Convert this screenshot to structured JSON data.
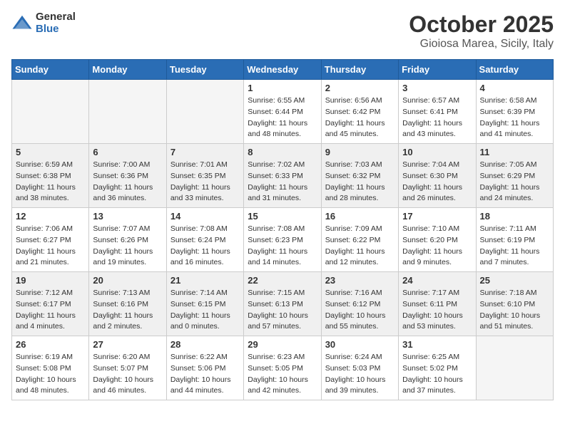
{
  "logo": {
    "general": "General",
    "blue": "Blue"
  },
  "title": "October 2025",
  "location": "Gioiosa Marea, Sicily, Italy",
  "days_of_week": [
    "Sunday",
    "Monday",
    "Tuesday",
    "Wednesday",
    "Thursday",
    "Friday",
    "Saturday"
  ],
  "weeks": [
    [
      {
        "day": "",
        "info": ""
      },
      {
        "day": "",
        "info": ""
      },
      {
        "day": "",
        "info": ""
      },
      {
        "day": "1",
        "info": "Sunrise: 6:55 AM\nSunset: 6:44 PM\nDaylight: 11 hours\nand 48 minutes."
      },
      {
        "day": "2",
        "info": "Sunrise: 6:56 AM\nSunset: 6:42 PM\nDaylight: 11 hours\nand 45 minutes."
      },
      {
        "day": "3",
        "info": "Sunrise: 6:57 AM\nSunset: 6:41 PM\nDaylight: 11 hours\nand 43 minutes."
      },
      {
        "day": "4",
        "info": "Sunrise: 6:58 AM\nSunset: 6:39 PM\nDaylight: 11 hours\nand 41 minutes."
      }
    ],
    [
      {
        "day": "5",
        "info": "Sunrise: 6:59 AM\nSunset: 6:38 PM\nDaylight: 11 hours\nand 38 minutes."
      },
      {
        "day": "6",
        "info": "Sunrise: 7:00 AM\nSunset: 6:36 PM\nDaylight: 11 hours\nand 36 minutes."
      },
      {
        "day": "7",
        "info": "Sunrise: 7:01 AM\nSunset: 6:35 PM\nDaylight: 11 hours\nand 33 minutes."
      },
      {
        "day": "8",
        "info": "Sunrise: 7:02 AM\nSunset: 6:33 PM\nDaylight: 11 hours\nand 31 minutes."
      },
      {
        "day": "9",
        "info": "Sunrise: 7:03 AM\nSunset: 6:32 PM\nDaylight: 11 hours\nand 28 minutes."
      },
      {
        "day": "10",
        "info": "Sunrise: 7:04 AM\nSunset: 6:30 PM\nDaylight: 11 hours\nand 26 minutes."
      },
      {
        "day": "11",
        "info": "Sunrise: 7:05 AM\nSunset: 6:29 PM\nDaylight: 11 hours\nand 24 minutes."
      }
    ],
    [
      {
        "day": "12",
        "info": "Sunrise: 7:06 AM\nSunset: 6:27 PM\nDaylight: 11 hours\nand 21 minutes."
      },
      {
        "day": "13",
        "info": "Sunrise: 7:07 AM\nSunset: 6:26 PM\nDaylight: 11 hours\nand 19 minutes."
      },
      {
        "day": "14",
        "info": "Sunrise: 7:08 AM\nSunset: 6:24 PM\nDaylight: 11 hours\nand 16 minutes."
      },
      {
        "day": "15",
        "info": "Sunrise: 7:08 AM\nSunset: 6:23 PM\nDaylight: 11 hours\nand 14 minutes."
      },
      {
        "day": "16",
        "info": "Sunrise: 7:09 AM\nSunset: 6:22 PM\nDaylight: 11 hours\nand 12 minutes."
      },
      {
        "day": "17",
        "info": "Sunrise: 7:10 AM\nSunset: 6:20 PM\nDaylight: 11 hours\nand 9 minutes."
      },
      {
        "day": "18",
        "info": "Sunrise: 7:11 AM\nSunset: 6:19 PM\nDaylight: 11 hours\nand 7 minutes."
      }
    ],
    [
      {
        "day": "19",
        "info": "Sunrise: 7:12 AM\nSunset: 6:17 PM\nDaylight: 11 hours\nand 4 minutes."
      },
      {
        "day": "20",
        "info": "Sunrise: 7:13 AM\nSunset: 6:16 PM\nDaylight: 11 hours\nand 2 minutes."
      },
      {
        "day": "21",
        "info": "Sunrise: 7:14 AM\nSunset: 6:15 PM\nDaylight: 11 hours\nand 0 minutes."
      },
      {
        "day": "22",
        "info": "Sunrise: 7:15 AM\nSunset: 6:13 PM\nDaylight: 10 hours\nand 57 minutes."
      },
      {
        "day": "23",
        "info": "Sunrise: 7:16 AM\nSunset: 6:12 PM\nDaylight: 10 hours\nand 55 minutes."
      },
      {
        "day": "24",
        "info": "Sunrise: 7:17 AM\nSunset: 6:11 PM\nDaylight: 10 hours\nand 53 minutes."
      },
      {
        "day": "25",
        "info": "Sunrise: 7:18 AM\nSunset: 6:10 PM\nDaylight: 10 hours\nand 51 minutes."
      }
    ],
    [
      {
        "day": "26",
        "info": "Sunrise: 6:19 AM\nSunset: 5:08 PM\nDaylight: 10 hours\nand 48 minutes."
      },
      {
        "day": "27",
        "info": "Sunrise: 6:20 AM\nSunset: 5:07 PM\nDaylight: 10 hours\nand 46 minutes."
      },
      {
        "day": "28",
        "info": "Sunrise: 6:22 AM\nSunset: 5:06 PM\nDaylight: 10 hours\nand 44 minutes."
      },
      {
        "day": "29",
        "info": "Sunrise: 6:23 AM\nSunset: 5:05 PM\nDaylight: 10 hours\nand 42 minutes."
      },
      {
        "day": "30",
        "info": "Sunrise: 6:24 AM\nSunset: 5:03 PM\nDaylight: 10 hours\nand 39 minutes."
      },
      {
        "day": "31",
        "info": "Sunrise: 6:25 AM\nSunset: 5:02 PM\nDaylight: 10 hours\nand 37 minutes."
      },
      {
        "day": "",
        "info": ""
      }
    ]
  ]
}
